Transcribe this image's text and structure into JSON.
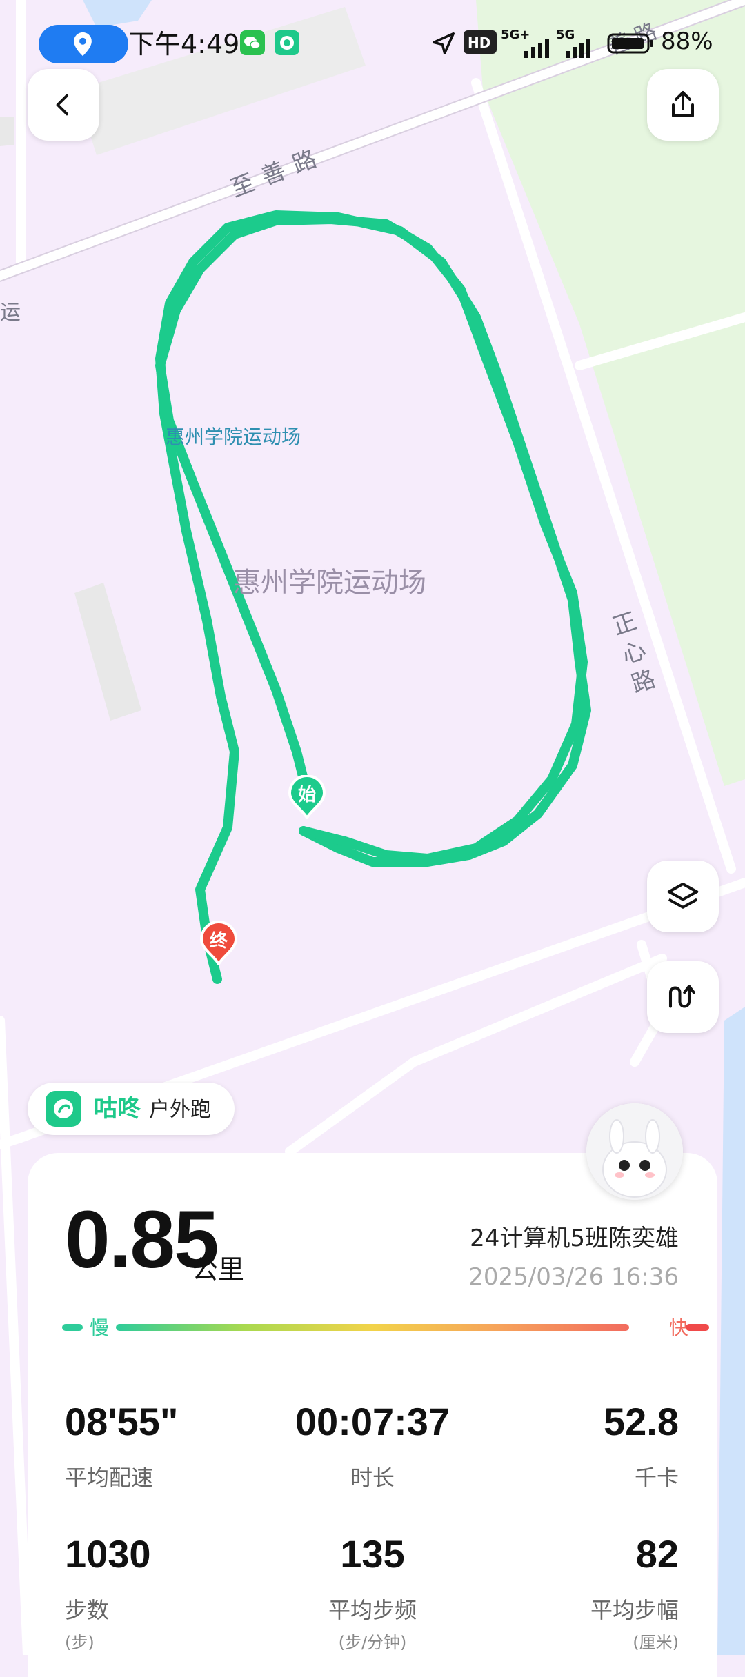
{
  "status": {
    "time": "下午4:49",
    "network1": "5G+",
    "network2": "5G",
    "battery": "88%"
  },
  "map": {
    "roads": [
      "至善路",
      "正心路",
      "运",
      "善路"
    ],
    "venue_label": "惠州学院运动场",
    "venue_label_big": "惠州学院运动场",
    "start_marker": "始",
    "end_marker": "终",
    "route_color": "#1ccb8c"
  },
  "brand": {
    "name": "咕咚",
    "mode": "户外跑"
  },
  "summary": {
    "distance": "0.85",
    "distance_unit": "公里",
    "user_name": "24计算机5班陈奕雄",
    "datetime": "2025/03/26 16:36",
    "pace_slow_label": "慢",
    "pace_fast_label": "快"
  },
  "stats": [
    {
      "value": "08'55\"",
      "label": "平均配速",
      "sub": ""
    },
    {
      "value": "00:07:37",
      "label": "时长",
      "sub": ""
    },
    {
      "value": "52.8",
      "label": "千卡",
      "sub": ""
    },
    {
      "value": "1030",
      "label": "步数",
      "sub": "(步)"
    },
    {
      "value": "135",
      "label": "平均步频",
      "sub": "(步/分钟)"
    },
    {
      "value": "82",
      "label": "平均步幅",
      "sub": "(厘米)"
    }
  ],
  "icons": {
    "back": "chevron-left-icon",
    "share": "share-icon",
    "layers": "layers-icon",
    "route_mode": "route-icon"
  }
}
